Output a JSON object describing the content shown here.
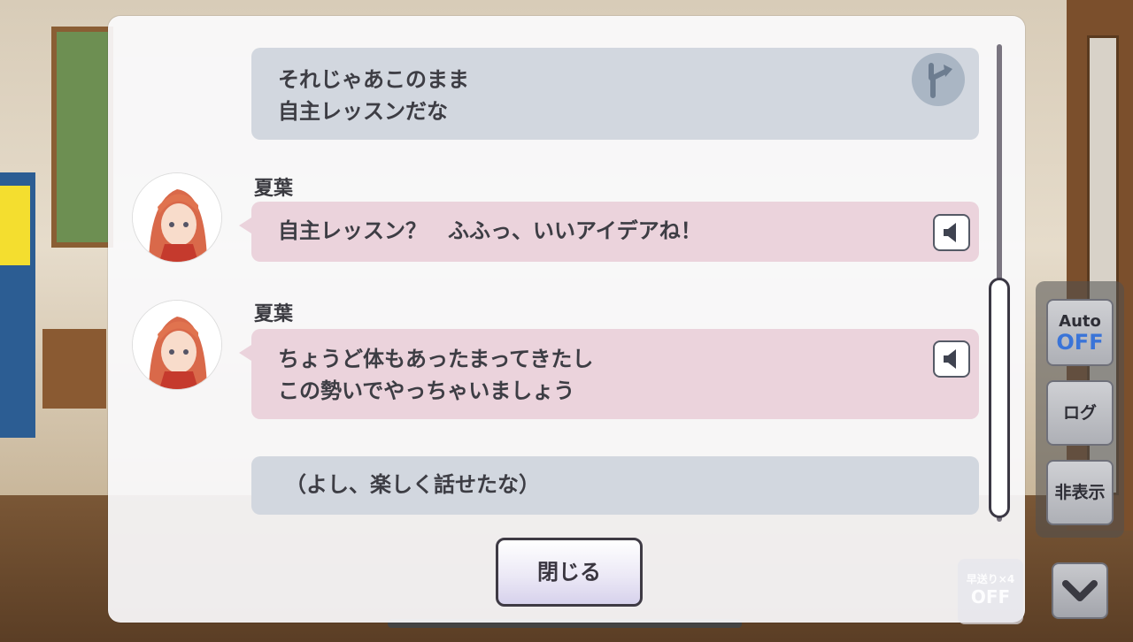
{
  "log": {
    "messages": [
      {
        "type": "player_choice",
        "lines": [
          "それじゃあこのまま",
          "自主レッスンだな"
        ]
      },
      {
        "type": "character",
        "speaker": "夏葉",
        "lines": [
          "自主レッスン？　ふふっ、いいアイデアね！"
        ]
      },
      {
        "type": "character",
        "speaker": "夏葉",
        "lines": [
          "ちょうど体もあったまってきたし",
          "この勢いでやっちゃいましょう"
        ]
      },
      {
        "type": "player_monologue",
        "lines": [
          "（よし、楽しく話せたな）"
        ]
      }
    ],
    "close_label": "閉じる"
  },
  "controls": {
    "auto_label": "Auto",
    "auto_state": "OFF",
    "log_label": "ログ",
    "hide_label": "非表示",
    "skip_label": "早送り×4",
    "skip_state": "OFF"
  },
  "colors": {
    "gray_bubble": "#d2d7df",
    "pink_bubble": "#ebd3dc",
    "auto_off_accent": "#3a74d8"
  },
  "icons": [
    "branch-arrow-icon",
    "speaker-icon",
    "chevron-down-icon"
  ]
}
